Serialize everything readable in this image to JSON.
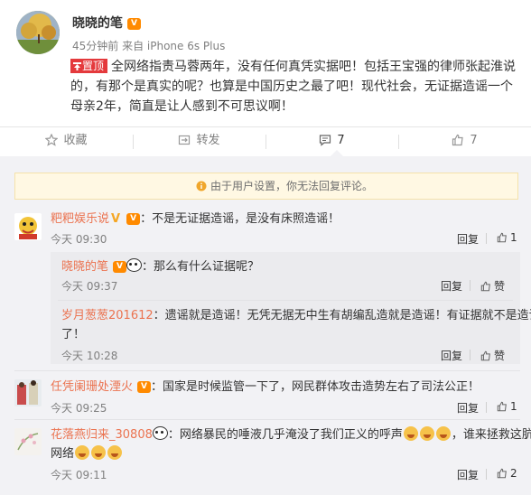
{
  "post": {
    "username": "晓晓的笔",
    "meta": "45分钟前 来自 iPhone 6s Plus",
    "pin_label": "置顶",
    "content": "全网络指责马蓉两年，没有任何真凭实据吧！包括王宝强的律师张起淮说的，有那个是真实的呢？也算是中国历史之最了吧！现代社会，无证据造谣一个母亲2年，简直是让人感到不可思议啊！"
  },
  "actions": {
    "favorite": "收藏",
    "repost": "转发",
    "comment_count": "7",
    "like_count": "7"
  },
  "notice": "由于用户设置，你无法回复评论。",
  "comments": [
    {
      "name": "粑粑娱乐说",
      "text": "：不是无证据造谣，是没有床照造谣！",
      "time": "今天 09:30",
      "reply": "回复",
      "likes": "1"
    },
    {
      "name": "晓晓的笔",
      "text": "：那么有什么证据呢？",
      "time": "今天 09:37",
      "reply": "回复",
      "like": "赞"
    },
    {
      "name": "岁月葱葱201612",
      "text_line1": "：遗谣就是造谣！无凭无据无中生有胡编乱造就是造谣！有证据就不是造谣",
      "text_line2": "了！",
      "time": "今天 10:28",
      "reply": "回复",
      "like": "赞"
    },
    {
      "name": "任凭阑珊处湮火",
      "text": "：国家是时候监管一下了，网民群体攻击造势左右了司法公正！",
      "time": "今天 09:25",
      "reply": "回复",
      "likes": "1"
    },
    {
      "name": "花落燕归来_30808",
      "text_line1": "：网络暴民的唾液几乎淹没了我们正义的呼声",
      "text_line1b": "，谁来拯救这肮脏的",
      "text_line2": "网络",
      "time": "今天 09:11",
      "reply": "回复",
      "likes": "2"
    }
  ],
  "colors": {
    "accent": "#eb7350",
    "pin": "#e4393c",
    "panel": "#f2f2f5"
  }
}
